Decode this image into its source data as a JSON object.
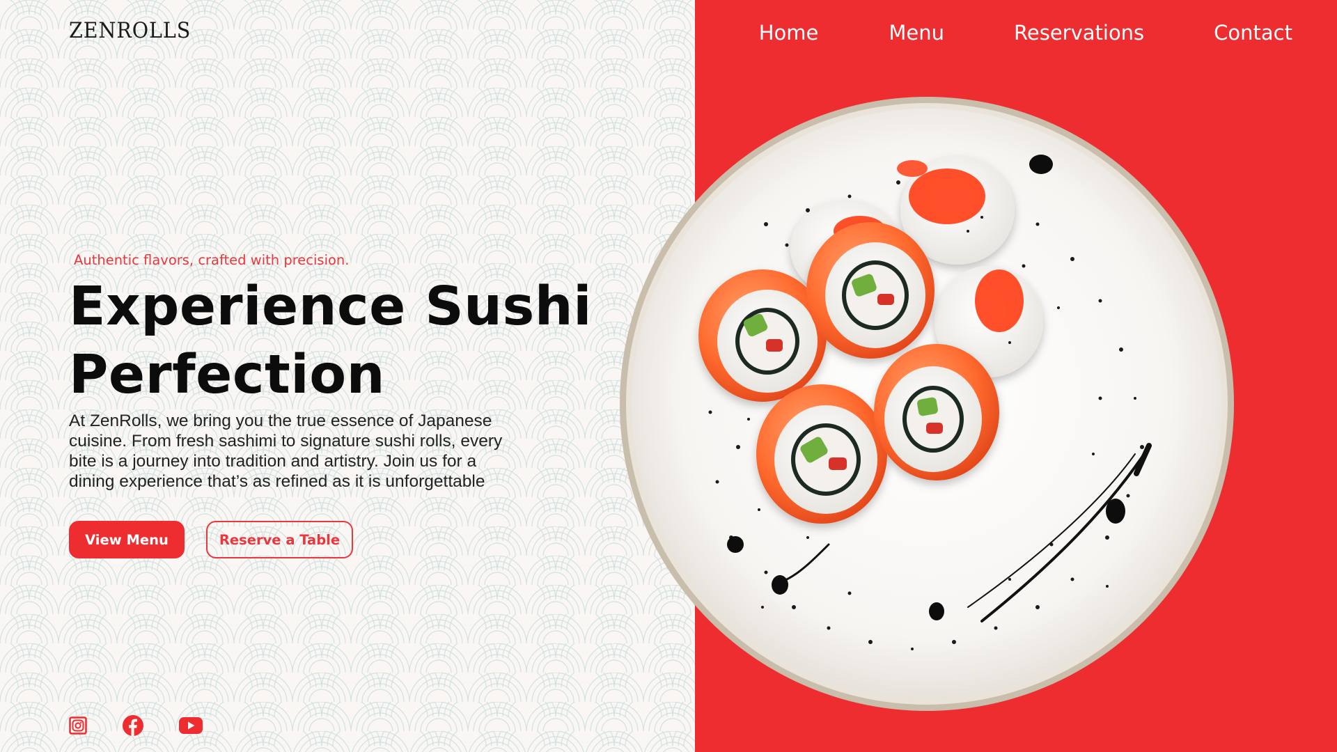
{
  "brand": {
    "logo_text": "ZENROLLS"
  },
  "nav": {
    "items": [
      {
        "label": "Home"
      },
      {
        "label": "Menu"
      },
      {
        "label": "Reservations"
      },
      {
        "label": "Contact"
      }
    ]
  },
  "hero": {
    "tagline": "Authentic flavors, crafted with precision.",
    "headline_line1": "Experience Sushi",
    "headline_line2": "Perfection",
    "description": "At ZenRolls, we bring you the true essence of Japanese cuisine. From fresh sashimi to signature sushi rolls, every bite is a journey into tradition and artistry. Join us for a dining experience that’s as refined as it is unforgettable",
    "primary_button": "View Menu",
    "secondary_button": "Reserve a Table"
  },
  "social": {
    "icons": [
      "instagram-icon",
      "facebook-icon",
      "youtube-icon"
    ]
  },
  "image": {
    "subject": "sushi-plate"
  },
  "colors": {
    "accent_red": "#ee2d31",
    "text_red": "#e8383d",
    "background": "#faf6f4",
    "pattern_line": "#c9dedd",
    "heading": "#0c0c0c"
  }
}
